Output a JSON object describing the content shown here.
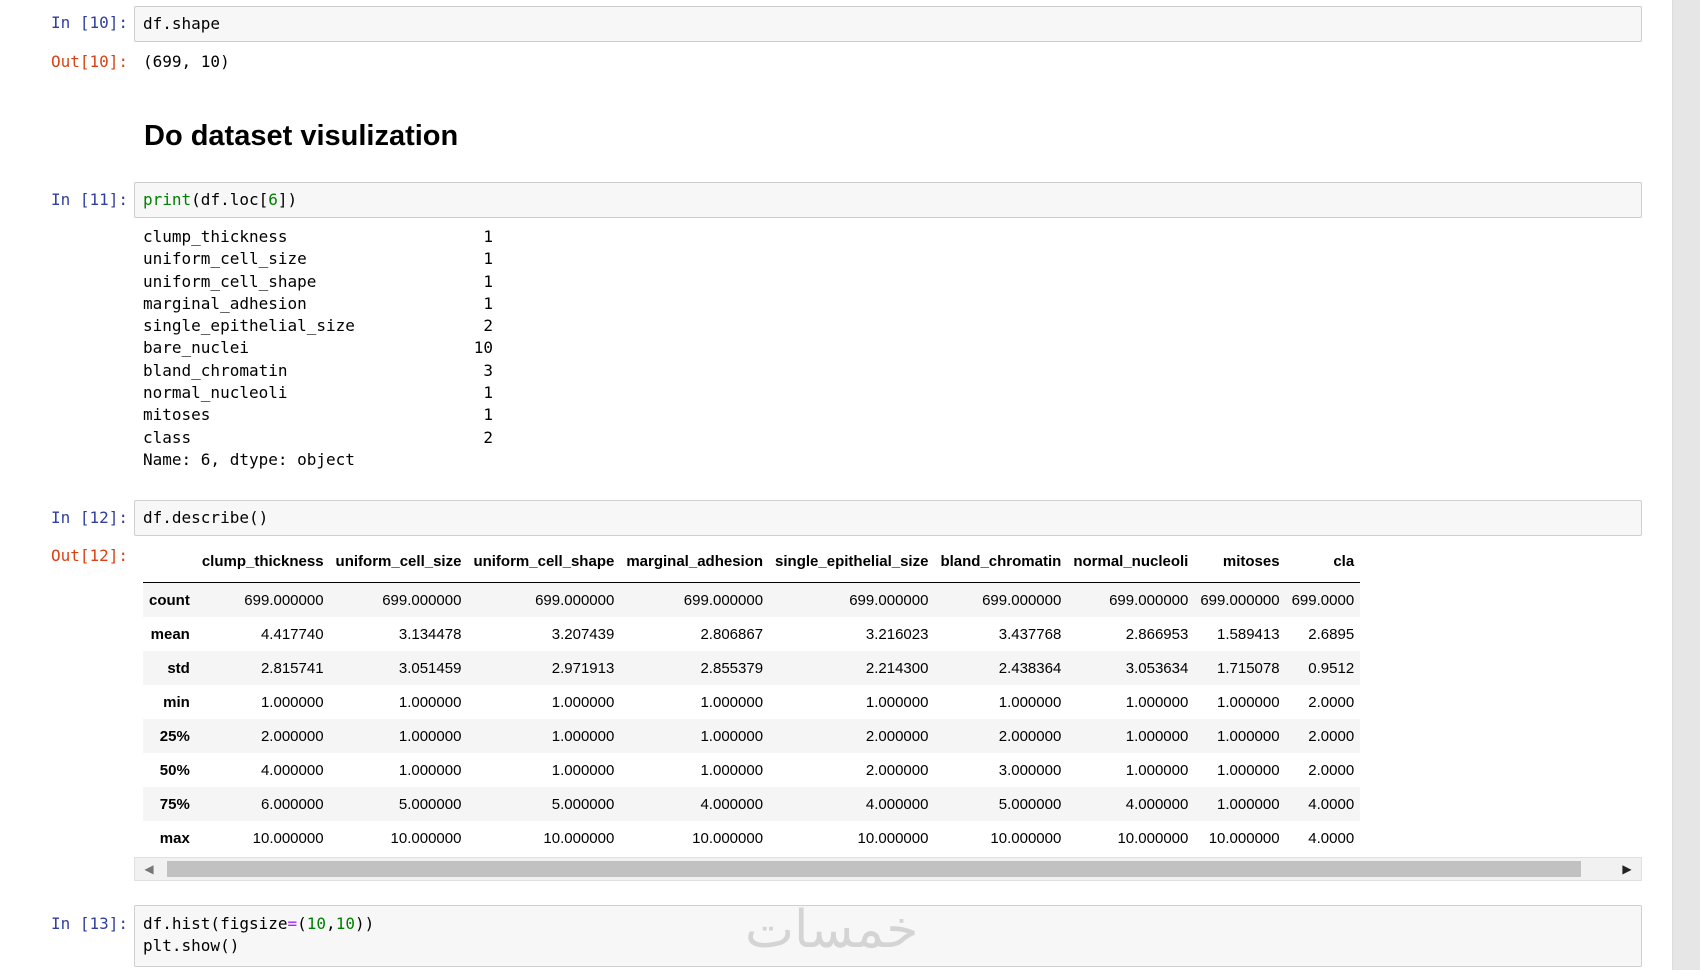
{
  "cells": {
    "c10": {
      "in_prompt": "In [10]:",
      "code": "df.shape",
      "out_prompt": "Out[10]:",
      "output": "(699, 10)"
    },
    "heading": "Do dataset visulization",
    "c11": {
      "in_prompt": "In [11]:",
      "code_fn": "print",
      "code_mid": "(df.loc[",
      "code_num": "6",
      "code_end": "])",
      "series": [
        {
          "key": "clump_thickness",
          "value": "1"
        },
        {
          "key": "uniform_cell_size",
          "value": "1"
        },
        {
          "key": "uniform_cell_shape",
          "value": "1"
        },
        {
          "key": "marginal_adhesion",
          "value": "1"
        },
        {
          "key": "single_epithelial_size",
          "value": "2"
        },
        {
          "key": "bare_nuclei",
          "value": "10"
        },
        {
          "key": "bland_chromatin",
          "value": "3"
        },
        {
          "key": "normal_nucleoli",
          "value": "1"
        },
        {
          "key": "mitoses",
          "value": "1"
        },
        {
          "key": "class",
          "value": "2"
        }
      ],
      "footer": "Name: 6, dtype: object"
    },
    "c12": {
      "in_prompt": "In [12]:",
      "code": "df.describe()",
      "out_prompt": "Out[12]:",
      "columns": [
        "clump_thickness",
        "uniform_cell_size",
        "uniform_cell_shape",
        "marginal_adhesion",
        "single_epithelial_size",
        "bland_chromatin",
        "normal_nucleoli",
        "mitoses",
        "cla"
      ],
      "rows": [
        {
          "label": "count",
          "values": [
            "699.000000",
            "699.000000",
            "699.000000",
            "699.000000",
            "699.000000",
            "699.000000",
            "699.000000",
            "699.000000",
            "699.0000"
          ]
        },
        {
          "label": "mean",
          "values": [
            "4.417740",
            "3.134478",
            "3.207439",
            "2.806867",
            "3.216023",
            "3.437768",
            "2.866953",
            "1.589413",
            "2.6895"
          ]
        },
        {
          "label": "std",
          "values": [
            "2.815741",
            "3.051459",
            "2.971913",
            "2.855379",
            "2.214300",
            "2.438364",
            "3.053634",
            "1.715078",
            "0.9512"
          ]
        },
        {
          "label": "min",
          "values": [
            "1.000000",
            "1.000000",
            "1.000000",
            "1.000000",
            "1.000000",
            "1.000000",
            "1.000000",
            "1.000000",
            "2.0000"
          ]
        },
        {
          "label": "25%",
          "values": [
            "2.000000",
            "1.000000",
            "1.000000",
            "1.000000",
            "2.000000",
            "2.000000",
            "1.000000",
            "1.000000",
            "2.0000"
          ]
        },
        {
          "label": "50%",
          "values": [
            "4.000000",
            "1.000000",
            "1.000000",
            "1.000000",
            "2.000000",
            "3.000000",
            "1.000000",
            "1.000000",
            "2.0000"
          ]
        },
        {
          "label": "75%",
          "values": [
            "6.000000",
            "5.000000",
            "5.000000",
            "4.000000",
            "4.000000",
            "5.000000",
            "4.000000",
            "1.000000",
            "4.0000"
          ]
        },
        {
          "label": "max",
          "values": [
            "10.000000",
            "10.000000",
            "10.000000",
            "10.000000",
            "10.000000",
            "10.000000",
            "10.000000",
            "10.000000",
            "4.0000"
          ]
        }
      ]
    },
    "c13": {
      "in_prompt": "In [13]:",
      "line1_a": "df.hist(figsize",
      "line1_op": "=",
      "line1_b": "(",
      "line1_n1": "10",
      "line1_c": ",",
      "line1_n2": "10",
      "line1_d": "))",
      "line2": "plt.show()"
    }
  },
  "watermark": "خمسات",
  "scroll": {
    "left_arrow": "◀",
    "right_arrow": "▶"
  }
}
